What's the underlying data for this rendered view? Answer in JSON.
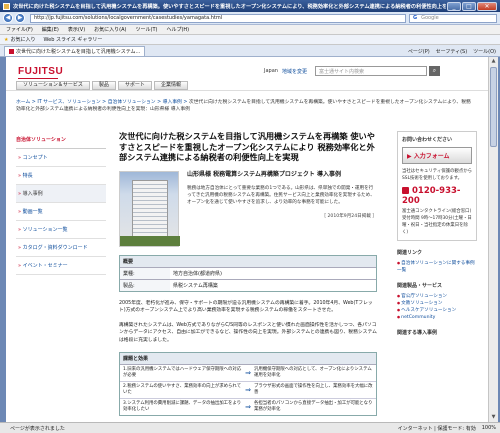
{
  "window": {
    "title": "次世代に向けた税システムを目指して汎用機システムを再構築。使いやすさとスピードを重視したオープン化システムにより、税務効率化と外部システム連携による納税者の利便性向上を実現 - Windows Internet Explorer",
    "minimize": "_",
    "maximize": "□",
    "close": "✕"
  },
  "browser": {
    "address": "http://jp.fujitsu.com/solutions/localgovernment/casestudies/yamagata.html",
    "search_engine": "G",
    "search_placeholder": "Google",
    "menu": [
      "ファイル(F)",
      "編集(E)",
      "表示(V)",
      "お気に入り(A)",
      "ツール(T)",
      "ヘルプ(H)"
    ],
    "favorites_label": "お気に入り",
    "favorites_item": "Web スライス ギャラリー",
    "tab_title": "次世代に向けた税システムを目指して汎用機システム...",
    "tab_tools": [
      "ページ(P)",
      "セーフティ(S)",
      "ツール(O)"
    ],
    "status_main": "ページが表示されました",
    "status_zone": "インターネット | 保護モード: 有効",
    "status_zoom": "100%"
  },
  "site": {
    "logo": "FUJITSU",
    "lang": "Japan",
    "region": "地域を変更",
    "search_placeholder": "富士通サイト内検索",
    "global_nav": [
      "ソリューション＆サービス",
      "製品",
      "サポート",
      "企業情報"
    ]
  },
  "breadcrumb": {
    "trail": "ホーム > IT サービス、ソリューション > 自治体ソリューション > 導入事例 > ",
    "current": "次世代に向けた税システムを目指して汎用機システムを再構築。使いやすさとスピードを重視したオープン化システムにより、税務効率化と外部システム連携による納税者の利便性向上を実現：山形県様 導入事例"
  },
  "leftnav": {
    "heading": "自治体ソリューション",
    "items": [
      "コンセプト",
      "特長",
      "導入事例",
      "動画一覧",
      "ソリューション一覧",
      "カタログ・資料ダウンロード",
      "イベント・セミナー"
    ]
  },
  "main": {
    "title": "次世代に向けた税システムを目指して汎用機システムを再構築 使いやすさとスピードを重視したオープン化システムにより 税務効率化と外部システム連携による納税者の利便性向上を実現",
    "subtitle": "山形県様 税務電算システム再構築プロジェクト 導入事例",
    "description": "税務は地方自治体にとって重要な業務の1つである。山形県は、県単独での開発・運用を行ってきた汎用機の税務システムを再構築。住民サービス向上と業務効率化を実現するため、オープン化を通じて使いやすさを追求し、より効率的な事務を可能にした。",
    "date": "［ 2010年9月24日掲載 ］",
    "overview_heading": "概要",
    "overview": [
      {
        "key": "業種:",
        "value": "地方自治体(都道府県)"
      },
      {
        "key": "製品:",
        "value": "県税システム再構築"
      }
    ],
    "para1": "2005年度、老朽化が進み、保守・サポートの期限が迫る汎用機システムの再構築に着手。2010年4月、Web(Tフレット)方式のオープンシステム上でより高い業務効率を実現する税務システムの稼働をスタートさせた。",
    "para2": "再構築されたシステムは、Web方式でありながらC/S同等のレスポンスと使い慣れた画面操作性を活かしつつ、各パソコンからデータにアクセス、自由に加工ができるなど、操作性の向上を実現。外部システムとの連携も図り、税務システムは格段に充実しました。",
    "issues_heading": "課題と効果",
    "issues": [
      {
        "problem": "1.旧来の汎用機システムではハードウェア保守期限への対応が必要",
        "effect": "汎用機保守期限への対応として、オープン化によりシステム運用を効率化"
      },
      {
        "problem": "2.税務システムの使いやすさ、業務効率の向上が求められていた",
        "effect": "ブラウザ形式の画面で操作性を向上し、業務効率を大幅に改善"
      },
      {
        "problem": "3.システム利用の費用削減に課題、データの抽出加工をより効率化したい",
        "effect": "各担当者のパソコンから直接データ抽出・加工が可能となり業務が効率化"
      }
    ]
  },
  "right": {
    "contact_title": "お問い合わせください",
    "form_button": "入力フォーム",
    "form_note": "当社はセキュリティ保護の観点からSSL技術を使用しております。",
    "phone": "0120-933-200",
    "phone_note": "富士通コンタクトライン(総合窓口) 受付時間 9時～17時30分(土曜・日曜・祝日・当社指定の休業日を除く)",
    "related_links_title": "関連リンク",
    "related_links": [
      "自治体ソリューションに関する事例一覧"
    ],
    "related_solutions_title": "関連製品・サービス",
    "related_solutions": [
      "官公庁ソリューション",
      "文教ソリューション",
      "ヘルスケアソリューション",
      "netCommunity"
    ],
    "more_title": "関連する導入事例"
  }
}
